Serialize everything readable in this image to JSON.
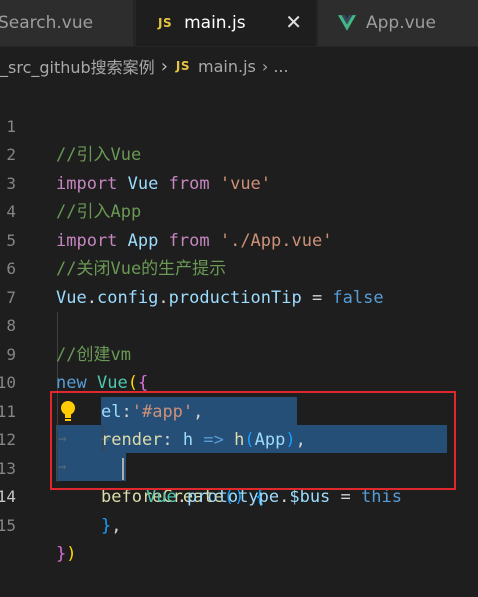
{
  "tabs": [
    {
      "label": "Search.vue",
      "icon": "vue-icon",
      "active": false
    },
    {
      "label": "main.js",
      "badge": "JS",
      "active": true,
      "close": "✕"
    },
    {
      "label": "App.vue",
      "icon": "vue-icon",
      "active": false
    }
  ],
  "breadcrumb": {
    "folder": "_src_github搜索案例",
    "separator": "›",
    "badge": "JS",
    "file": "main.js",
    "more": "› ..."
  },
  "lines": [
    {
      "num": "1"
    },
    {
      "num": "2"
    },
    {
      "num": "3"
    },
    {
      "num": "4"
    },
    {
      "num": "5"
    },
    {
      "num": "6"
    },
    {
      "num": "7"
    },
    {
      "num": "8"
    },
    {
      "num": "9"
    },
    {
      "num": "10"
    },
    {
      "num": "11"
    },
    {
      "num": "12"
    },
    {
      "num": "13"
    },
    {
      "num": "14"
    },
    {
      "num": "15"
    }
  ],
  "code": {
    "l1": "//引入Vue",
    "l2": {
      "kw": "import",
      "name": "Vue",
      "from": "from",
      "src": "'vue'"
    },
    "l3": "//引入App",
    "l4": {
      "kw": "import",
      "name": "App",
      "from": "from",
      "src": "'./App.vue'"
    },
    "l5": "//关闭Vue的生产提示",
    "l6": {
      "obj": "Vue",
      "dot1": ".",
      "prop1": "config",
      "dot2": ".",
      "prop2": "productionTip",
      "eq": " = ",
      "val": "false"
    },
    "l8": "//创建vm",
    "l9": {
      "kw": "new",
      "cls": "Vue",
      "open": "(",
      "brace": "{"
    },
    "l10": {
      "key": "el",
      "colon": ":",
      "val": "'#app'",
      "comma": ","
    },
    "l11": {
      "key": "render",
      "colon": ": ",
      "param": "h",
      "arrow": " => ",
      "fn": "h",
      "open": "(",
      "arg": "App",
      "close": ")",
      "comma": ","
    },
    "l12": {
      "fn": "beforeCreate",
      "parens": "()",
      "brace": " {"
    },
    "l13": {
      "obj": "Vue",
      "dot1": ".",
      "prop1": "prototype",
      "dot2": ".",
      "prop2": "$bus",
      "eq": " = ",
      "val": "this"
    },
    "l14": {
      "brace": "}",
      "comma": ","
    },
    "l15": {
      "brace": "}",
      "paren": ")"
    }
  },
  "tab_arrow": "→",
  "colors": {
    "background": "#1e1e1e",
    "selection": "#264f78",
    "highlight_box": "#e0282d",
    "keyword": "#569cd6",
    "import_keyword": "#c586c0",
    "string": "#ce9178",
    "comment": "#6a9955",
    "class": "#4ec9b0",
    "function": "#dcdcaa",
    "variable": "#9cdcfe"
  }
}
